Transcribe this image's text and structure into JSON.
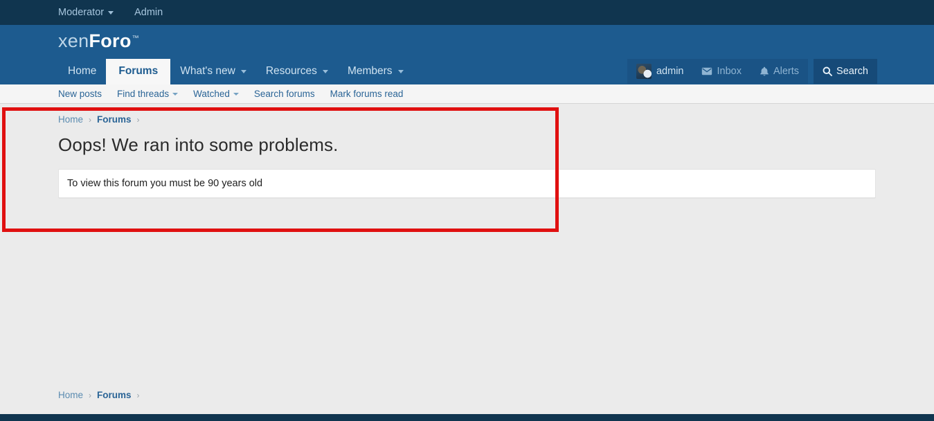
{
  "topbar": {
    "items": [
      {
        "label": "Moderator",
        "has_caret": true
      },
      {
        "label": "Admin",
        "has_caret": false
      }
    ]
  },
  "header": {
    "logo": {
      "part1": "xen",
      "part2": "Foro",
      "trademark": "™"
    },
    "nav": [
      {
        "label": "Home",
        "active": false,
        "has_caret": false
      },
      {
        "label": "Forums",
        "active": true,
        "has_caret": false
      },
      {
        "label": "What's new",
        "active": false,
        "has_caret": true
      },
      {
        "label": "Resources",
        "active": false,
        "has_caret": true
      },
      {
        "label": "Members",
        "active": false,
        "has_caret": true
      }
    ],
    "user": {
      "username": "admin",
      "inbox_label": "Inbox",
      "alerts_label": "Alerts",
      "search_label": "Search"
    }
  },
  "subnav": {
    "items": [
      {
        "label": "New posts",
        "has_caret": false
      },
      {
        "label": "Find threads",
        "has_caret": true
      },
      {
        "label": "Watched",
        "has_caret": true
      },
      {
        "label": "Search forums",
        "has_caret": false
      },
      {
        "label": "Mark forums read",
        "has_caret": false
      }
    ]
  },
  "breadcrumb": {
    "home": "Home",
    "forums": "Forums",
    "separator": "›"
  },
  "main": {
    "title": "Oops! We ran into some problems.",
    "error_message": "To view this forum you must be 90 years old"
  },
  "footer_breadcrumb": {
    "home": "Home",
    "forums": "Forums",
    "separator": "›"
  },
  "colors": {
    "topbar_bg": "#10354f",
    "header_bg": "#1d5b8f",
    "page_bg": "#ebebeb",
    "link": "#2a6496",
    "annotation": "#e01010"
  }
}
